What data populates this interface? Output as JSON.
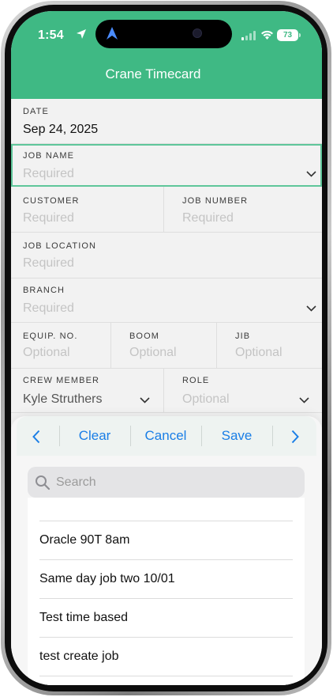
{
  "status": {
    "time": "1:54",
    "battery": "73"
  },
  "header": {
    "title": "Crane Timecard"
  },
  "form": {
    "date": {
      "label": "DATE",
      "value": "Sep 24, 2025"
    },
    "job_name": {
      "label": "JOB NAME",
      "placeholder": "Required"
    },
    "customer": {
      "label": "CUSTOMER",
      "placeholder": "Required"
    },
    "job_number": {
      "label": "JOB NUMBER",
      "placeholder": "Required"
    },
    "job_location": {
      "label": "JOB LOCATION",
      "placeholder": "Required"
    },
    "branch": {
      "label": "BRANCH",
      "placeholder": "Required"
    },
    "equip_no": {
      "label": "EQUIP. NO.",
      "placeholder": "Optional"
    },
    "boom": {
      "label": "BOOM",
      "placeholder": "Optional"
    },
    "jib": {
      "label": "JIB",
      "placeholder": "Optional"
    },
    "crew_member": {
      "label": "CREW MEMBER",
      "value": "Kyle Struthers"
    },
    "role": {
      "label": "ROLE",
      "placeholder": "Optional"
    }
  },
  "picker": {
    "toolbar": {
      "clear": "Clear",
      "cancel": "Cancel",
      "save": "Save"
    },
    "search": {
      "placeholder": "Search"
    },
    "items": [
      "Oracle 90T 8am",
      "Same day job two 10/01",
      "Test time based",
      "test create job"
    ]
  },
  "colors": {
    "header_green": "#3fb984",
    "accent_blue": "#1a7ee6",
    "focus_border": "#5fc69a"
  }
}
